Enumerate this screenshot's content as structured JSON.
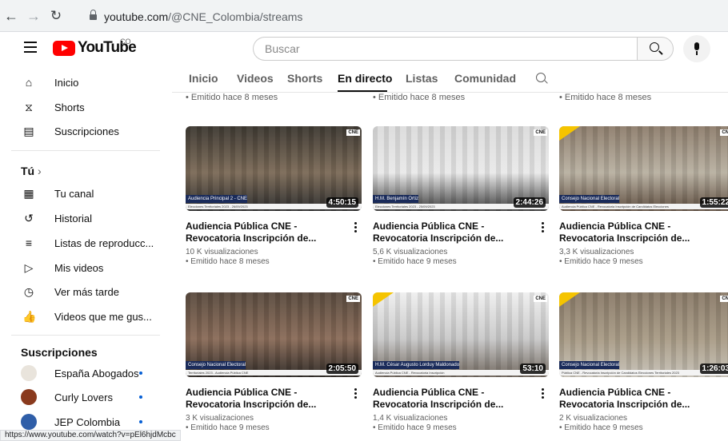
{
  "browser": {
    "url_host": "youtube.com",
    "url_path": "/@CNE_Colombia/streams",
    "status_url": "https://www.youtube.com/watch?v=pEl6hjdMcbc"
  },
  "header": {
    "logo_text": "YouTube",
    "country_code": "CO",
    "search_placeholder": "Buscar"
  },
  "sidebar": {
    "main": [
      {
        "label": "Inicio",
        "icon": "home-icon"
      },
      {
        "label": "Shorts",
        "icon": "shorts-icon"
      },
      {
        "label": "Suscripciones",
        "icon": "subscriptions-icon"
      }
    ],
    "you_heading": "Tú",
    "you": [
      {
        "label": "Tu canal",
        "icon": "channel-icon"
      },
      {
        "label": "Historial",
        "icon": "history-icon"
      },
      {
        "label": "Listas de reproducc...",
        "icon": "playlists-icon"
      },
      {
        "label": "Mis videos",
        "icon": "my-videos-icon"
      },
      {
        "label": "Ver más tarde",
        "icon": "watch-later-icon"
      },
      {
        "label": "Videos que me gus...",
        "icon": "liked-icon"
      }
    ],
    "subs_heading": "Suscripciones",
    "subs": [
      {
        "label": "España Abogados",
        "color": "#e9e4dc"
      },
      {
        "label": "Curly Lovers",
        "color": "#8a3a1e"
      },
      {
        "label": "JEP Colombia",
        "color": "#2f5ea8"
      }
    ]
  },
  "tabs": [
    {
      "label": "Inicio",
      "active": false
    },
    {
      "label": "Videos",
      "active": false
    },
    {
      "label": "Shorts",
      "active": false
    },
    {
      "label": "En directo",
      "active": true
    },
    {
      "label": "Listas",
      "active": false
    },
    {
      "label": "Comunidad",
      "active": false
    }
  ],
  "previous_row_meta": [
    "• Emitido hace 8 meses",
    "• Emitido hace 8 meses",
    "• Emitido hace 8 meses"
  ],
  "videos": [
    {
      "title1": "Audiencia Pública CNE -",
      "title2": "Revocatoria Inscripción de...",
      "views": "10 K visualizaciones",
      "age": "• Emitido hace 8 meses",
      "duration": "4:50:15",
      "banner": "Audiencia Principal 2 - CNE",
      "sub": "Elecciones Territoriales 2023 - 26/09/2023",
      "logo": "CNE"
    },
    {
      "title1": "Audiencia Pública CNE -",
      "title2": "Revocatoria Inscripción de...",
      "views": "5,6 K visualizaciones",
      "age": "• Emitido hace 9 meses",
      "duration": "2:44:26",
      "banner": "H.M. Benjamín Ortiz",
      "sub": "Elecciones Territoriales 2023 - 25/09/2023",
      "logo": "CNE"
    },
    {
      "title1": "Audiencia Pública CNE -",
      "title2": "Revocatoria Inscripción de...",
      "views": "3,3 K visualizaciones",
      "age": "• Emitido hace 9 meses",
      "duration": "1:55:22",
      "banner": "Consejo Nacional Electoral",
      "sub": "Audiencia Pública CNE - Revocatoria Inscripción de Candidatos Elecciones",
      "logo": "CNE"
    },
    {
      "title1": "Audiencia Pública CNE -",
      "title2": "Revocatoria Inscripción de...",
      "views": "3 K visualizaciones",
      "age": "• Emitido hace 9 meses",
      "duration": "2:05:50",
      "banner": "Consejo Nacional Electoral",
      "sub": "Territoriales 2023 - Audiencia Pública CNE",
      "logo": "CNE"
    },
    {
      "title1": "Audiencia Pública CNE -",
      "title2": "Revocatoria Inscripción de...",
      "views": "1,4 K visualizaciones",
      "age": "• Emitido hace 9 meses",
      "duration": "53:10",
      "banner": "H.M. César Augusto Lorduy Maldonado",
      "sub": "Audiencia Pública CNE - Revocatoria Inscripción",
      "logo": "CNE"
    },
    {
      "title1": "Audiencia Pública CNE -",
      "title2": "Revocatoria Inscripción de...",
      "views": "2 K visualizaciones",
      "age": "• Emitido hace 9 meses",
      "duration": "1:26:03",
      "banner": "Consejo Nacional Electoral",
      "sub": "Pública CNE - Revocatoria Inscripción de Candidatos Elecciones Territoriales 2023",
      "logo": "CNE"
    }
  ]
}
